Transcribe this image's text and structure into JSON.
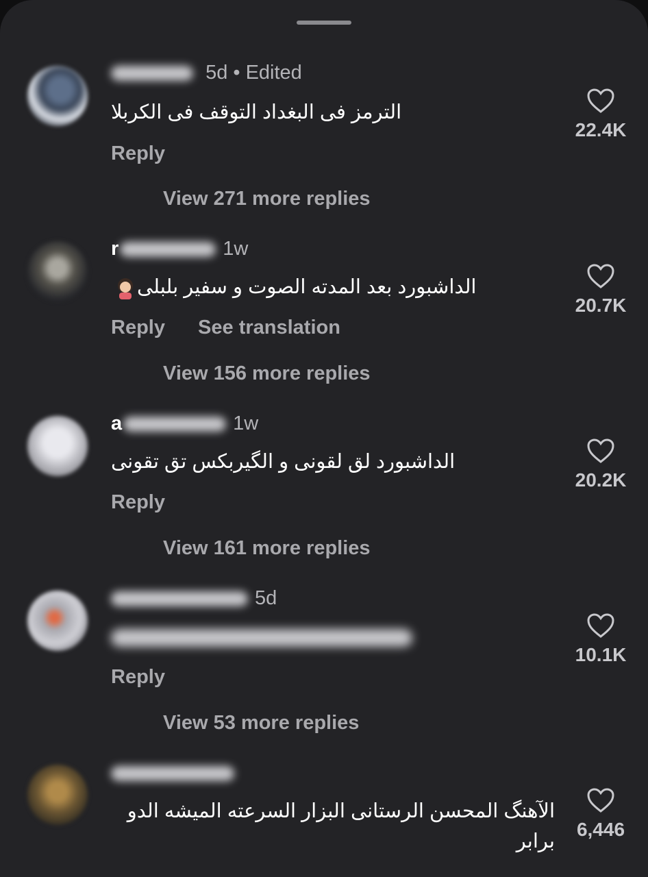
{
  "comments": [
    {
      "name": "",
      "time": "5d • Edited",
      "text": "الترمز فی البغداد التوقف فی الکربلا",
      "actions": [
        "Reply"
      ],
      "view_replies": "View 271 more replies",
      "likes": "22.4K"
    },
    {
      "name": "r",
      "time": "1w",
      "text": "الداشبورد بعد المدته الصوت و سفیر بلبلی",
      "actions": [
        "Reply",
        "See translation"
      ],
      "view_replies": "View 156 more replies",
      "likes": "20.7K"
    },
    {
      "name": "a",
      "time": "1w",
      "text": "الداشبورد لق لقونی و الگیربکس تق تقونی",
      "actions": [
        "Reply"
      ],
      "view_replies": "View 161 more replies",
      "likes": "20.2K"
    },
    {
      "name": "",
      "time": "5d",
      "text": "",
      "actions": [
        "Reply"
      ],
      "view_replies": "View 53 more replies",
      "likes": "10.1K"
    },
    {
      "name": "",
      "time": "",
      "text": "الآهنگ المحسن الرستانی البزار السرعته المیشه الدو برابر",
      "actions": [],
      "view_replies": "",
      "likes": "6,446"
    }
  ],
  "icons": {
    "like": "heart-outline-icon",
    "drag_handle": "sheet-handle"
  },
  "colors": {
    "background": "#232326",
    "text_primary": "#ffffff",
    "text_secondary": "#a9a9ad"
  }
}
